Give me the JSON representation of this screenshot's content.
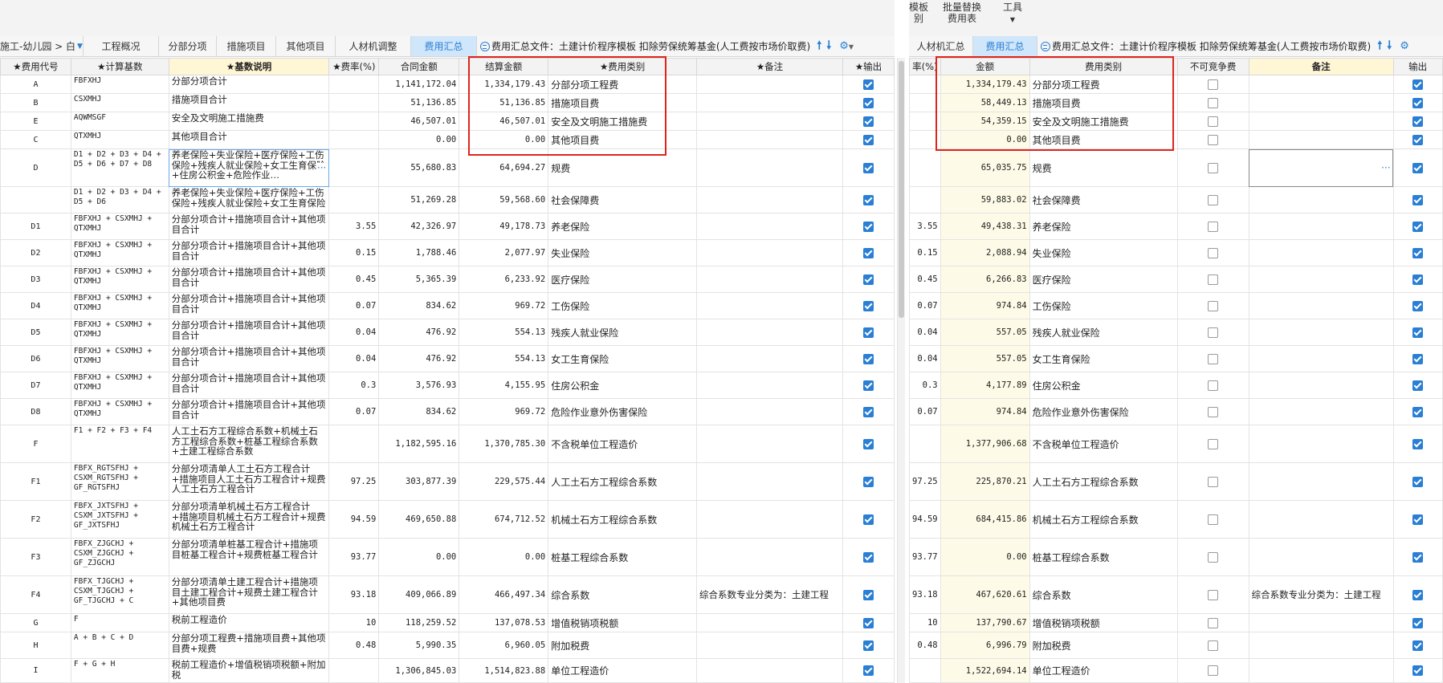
{
  "left": {
    "breadcrumb": "施工-幼儿园 > 白",
    "tabs": [
      "工程概况",
      "分部分项",
      "措施项目",
      "其他项目",
      "人材机调整",
      "费用汇总"
    ],
    "active_tab": "费用汇总",
    "file_label": "费用汇总文件：土建计价程序模板 扣除劳保统筹基金(人工费按市场价取费)",
    "columns": [
      "★费用代号",
      "★计算基数",
      "★基数说明",
      "★费率(%)",
      "合同金额",
      "结算金额",
      "★费用类别",
      "★备注",
      "★输出"
    ],
    "rows": [
      {
        "code": "A",
        "base": "FBFXHJ",
        "desc": "分部分项合计",
        "rate": "",
        "contract": "1,141,172.04",
        "settle": "1,334,179.43",
        "cat": "分部分项工程费",
        "note": ""
      },
      {
        "code": "B",
        "base": "CSXMHJ",
        "desc": "措施项目合计",
        "rate": "",
        "contract": "51,136.85",
        "settle": "51,136.85",
        "cat": "措施项目费",
        "note": ""
      },
      {
        "code": "E",
        "base": "AQWMSGF",
        "desc": "安全及文明施工措施费",
        "rate": "",
        "contract": "46,507.01",
        "settle": "46,507.01",
        "cat": "安全及文明施工措施费",
        "note": ""
      },
      {
        "code": "C",
        "base": "QTXMHJ",
        "desc": "其他项目合计",
        "rate": "",
        "contract": "0.00",
        "settle": "0.00",
        "cat": "其他项目费",
        "note": ""
      },
      {
        "code": "D",
        "base": "D1 + D2 + D3 + D4 + D5 + D6 + D7 + D8",
        "desc": "养老保险+失业保险+医疗保险+工伤保险+残疾人就业保险+女工生育保险+住房公积金+危险作业…",
        "rate": "",
        "contract": "55,680.83",
        "settle": "64,694.27",
        "cat": "规费",
        "note": ""
      },
      {
        "code": "",
        "base": "D1 + D2 + D3 + D4 + D5 + D6",
        "desc": "养老保险+失业保险+医疗保险+工伤保险+残疾人就业保险+女工生育保险",
        "rate": "",
        "contract": "51,269.28",
        "settle": "59,568.60",
        "cat": "社会保障费",
        "note": ""
      },
      {
        "code": "D1",
        "base": "FBFXHJ + CSXMHJ + QTXMHJ",
        "desc": "分部分项合计+措施项目合计+其他项目合计",
        "rate": "3.55",
        "contract": "42,326.97",
        "settle": "49,178.73",
        "cat": "养老保险",
        "note": ""
      },
      {
        "code": "D2",
        "base": "FBFXHJ + CSXMHJ + QTXMHJ",
        "desc": "分部分项合计+措施项目合计+其他项目合计",
        "rate": "0.15",
        "contract": "1,788.46",
        "settle": "2,077.97",
        "cat": "失业保险",
        "note": ""
      },
      {
        "code": "D3",
        "base": "FBFXHJ + CSXMHJ + QTXMHJ",
        "desc": "分部分项合计+措施项目合计+其他项目合计",
        "rate": "0.45",
        "contract": "5,365.39",
        "settle": "6,233.92",
        "cat": "医疗保险",
        "note": ""
      },
      {
        "code": "D4",
        "base": "FBFXHJ + CSXMHJ + QTXMHJ",
        "desc": "分部分项合计+措施项目合计+其他项目合计",
        "rate": "0.07",
        "contract": "834.62",
        "settle": "969.72",
        "cat": "工伤保险",
        "note": ""
      },
      {
        "code": "D5",
        "base": "FBFXHJ + CSXMHJ + QTXMHJ",
        "desc": "分部分项合计+措施项目合计+其他项目合计",
        "rate": "0.04",
        "contract": "476.92",
        "settle": "554.13",
        "cat": "残疾人就业保险",
        "note": ""
      },
      {
        "code": "D6",
        "base": "FBFXHJ + CSXMHJ + QTXMHJ",
        "desc": "分部分项合计+措施项目合计+其他项目合计",
        "rate": "0.04",
        "contract": "476.92",
        "settle": "554.13",
        "cat": "女工生育保险",
        "note": ""
      },
      {
        "code": "D7",
        "base": "FBFXHJ + CSXMHJ + QTXMHJ",
        "desc": "分部分项合计+措施项目合计+其他项目合计",
        "rate": "0.3",
        "contract": "3,576.93",
        "settle": "4,155.95",
        "cat": "住房公积金",
        "note": ""
      },
      {
        "code": "D8",
        "base": "FBFXHJ + CSXMHJ + QTXMHJ",
        "desc": "分部分项合计+措施项目合计+其他项目合计",
        "rate": "0.07",
        "contract": "834.62",
        "settle": "969.72",
        "cat": "危险作业意外伤害保险",
        "note": ""
      },
      {
        "code": "F",
        "base": "F1 + F2 + F3 + F4",
        "desc": "人工土石方工程综合系数+机械土石方工程综合系数+桩基工程综合系数+土建工程综合系数",
        "rate": "",
        "contract": "1,182,595.16",
        "settle": "1,370,785.30",
        "cat": "不含税单位工程造价",
        "note": ""
      },
      {
        "code": "F1",
        "base": "FBFX_RGTSFHJ + CSXM_RGTSFHJ + GF_RGTSFHJ",
        "desc": "分部分项清单人工土石方工程合计+措施项目人工土石方工程合计+规费人工土石方工程合计",
        "rate": "97.25",
        "contract": "303,877.39",
        "settle": "229,575.44",
        "cat": "人工土石方工程综合系数",
        "note": ""
      },
      {
        "code": "F2",
        "base": "FBFX_JXTSFHJ + CSXM_JXTSFHJ + GF_JXTSFHJ",
        "desc": "分部分项清单机械土石方工程合计+措施项目机械土石方工程合计+规费机械土石方工程合计",
        "rate": "94.59",
        "contract": "469,650.88",
        "settle": "674,712.52",
        "cat": "机械土石方工程综合系数",
        "note": ""
      },
      {
        "code": "F3",
        "base": "FBFX_ZJGCHJ + CSXM_ZJGCHJ + GF_ZJGCHJ",
        "desc": "分部分项清单桩基工程合计+措施项目桩基工程合计+规费桩基工程合计",
        "rate": "93.77",
        "contract": "0.00",
        "settle": "0.00",
        "cat": "桩基工程综合系数",
        "note": ""
      },
      {
        "code": "F4",
        "base": "FBFX_TJGCHJ + CSXM_TJGCHJ + GF_TJGCHJ + C",
        "desc": "分部分项清单土建工程合计+措施项目土建工程合计+规费土建工程合计+其他项目费",
        "rate": "93.18",
        "contract": "409,066.89",
        "settle": "466,497.34",
        "cat": "综合系数",
        "note": "综合系数专业分类为：土建工程"
      },
      {
        "code": "G",
        "base": "F",
        "desc": "税前工程造价",
        "rate": "10",
        "contract": "118,259.52",
        "settle": "137,078.53",
        "cat": "增值税销项税额",
        "note": ""
      },
      {
        "code": "H",
        "base": "A + B + C + D",
        "desc": "分部分项工程费+措施项目费+其他项目费+规费",
        "rate": "0.48",
        "contract": "5,990.35",
        "settle": "6,960.05",
        "cat": "附加税费",
        "note": ""
      },
      {
        "code": "I",
        "base": "F + G + H",
        "desc": "税前工程造价+增值税销项税额+附加税",
        "rate": "",
        "contract": "1,306,845.03",
        "settle": "1,514,823.88",
        "cat": "单位工程造价",
        "note": ""
      }
    ]
  },
  "right": {
    "toolbar": {
      "t1a": "模板",
      "t1b": "别",
      "t2a": "批量替换",
      "t2b": "费用表",
      "t3": "工具"
    },
    "tabs": [
      "人材机汇总",
      "费用汇总"
    ],
    "active_tab": "费用汇总",
    "file_label": "费用汇总文件：土建计价程序模板 扣除劳保统筹基金(人工费按市场价取费)",
    "columns": [
      "率(%)",
      "金额",
      "费用类别",
      "不可竞争费",
      "备注",
      "输出"
    ],
    "rows": [
      {
        "rate": "",
        "amount": "1,334,179.43",
        "cat": "分部分项工程费",
        "note": ""
      },
      {
        "rate": "",
        "amount": "58,449.13",
        "cat": "措施项目费",
        "note": ""
      },
      {
        "rate": "",
        "amount": "54,359.15",
        "cat": "安全及文明施工措施费",
        "note": ""
      },
      {
        "rate": "",
        "amount": "0.00",
        "cat": "其他项目费",
        "note": ""
      },
      {
        "rate": "",
        "amount": "65,035.75",
        "cat": "规费",
        "note": ""
      },
      {
        "rate": "",
        "amount": "59,883.02",
        "cat": "社会保障费",
        "note": ""
      },
      {
        "rate": "3.55",
        "amount": "49,438.31",
        "cat": "养老保险",
        "note": ""
      },
      {
        "rate": "0.15",
        "amount": "2,088.94",
        "cat": "失业保险",
        "note": ""
      },
      {
        "rate": "0.45",
        "amount": "6,266.83",
        "cat": "医疗保险",
        "note": ""
      },
      {
        "rate": "0.07",
        "amount": "974.84",
        "cat": "工伤保险",
        "note": ""
      },
      {
        "rate": "0.04",
        "amount": "557.05",
        "cat": "残疾人就业保险",
        "note": ""
      },
      {
        "rate": "0.04",
        "amount": "557.05",
        "cat": "女工生育保险",
        "note": ""
      },
      {
        "rate": "0.3",
        "amount": "4,177.89",
        "cat": "住房公积金",
        "note": ""
      },
      {
        "rate": "0.07",
        "amount": "974.84",
        "cat": "危险作业意外伤害保险",
        "note": ""
      },
      {
        "rate": "",
        "amount": "1,377,906.68",
        "cat": "不含税单位工程造价",
        "note": ""
      },
      {
        "rate": "97.25",
        "amount": "225,870.21",
        "cat": "人工土石方工程综合系数",
        "note": ""
      },
      {
        "rate": "94.59",
        "amount": "684,415.86",
        "cat": "机械土石方工程综合系数",
        "note": ""
      },
      {
        "rate": "93.77",
        "amount": "0.00",
        "cat": "桩基工程综合系数",
        "note": ""
      },
      {
        "rate": "93.18",
        "amount": "467,620.61",
        "cat": "综合系数",
        "note": "综合系数专业分类为：土建工程"
      },
      {
        "rate": "10",
        "amount": "137,790.67",
        "cat": "增值税销项税额",
        "note": ""
      },
      {
        "rate": "0.48",
        "amount": "6,996.79",
        "cat": "附加税费",
        "note": ""
      },
      {
        "rate": "",
        "amount": "1,522,694.14",
        "cat": "单位工程造价",
        "note": ""
      }
    ]
  },
  "colors": {
    "accent": "#2a7fd4",
    "highlight": "#e0241b",
    "amount_bg": "#fdfbe7"
  }
}
